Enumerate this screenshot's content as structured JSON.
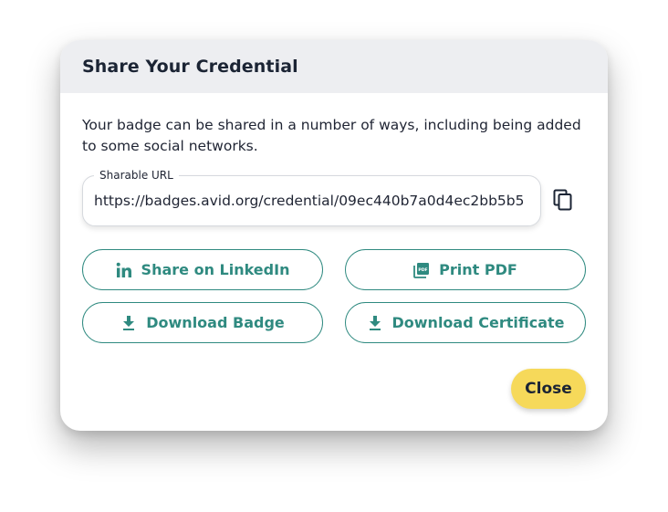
{
  "dialog": {
    "title": "Share Your Credential",
    "description": "Your badge can be shared in a number of ways, including being added to some social networks.",
    "url_field": {
      "label": "Sharable URL",
      "value": "https://badges.avid.org/credential/09ec440b7a0d4ec2bb5b5"
    },
    "copy_icon": "copy-icon",
    "buttons": {
      "linkedin": {
        "label": "Share on LinkedIn",
        "icon": "linkedin-icon"
      },
      "print_pdf": {
        "label": "Print PDF",
        "icon": "pdf-icon"
      },
      "download_badge": {
        "label": "Download Badge",
        "icon": "download-icon"
      },
      "download_certificate": {
        "label": "Download Certificate",
        "icon": "download-icon"
      }
    },
    "close_label": "Close"
  },
  "colors": {
    "header_bg": "#edeef1",
    "accent_teal": "#2f8a80",
    "close_yellow": "#f6d95a",
    "text_dark": "#1b2434"
  }
}
